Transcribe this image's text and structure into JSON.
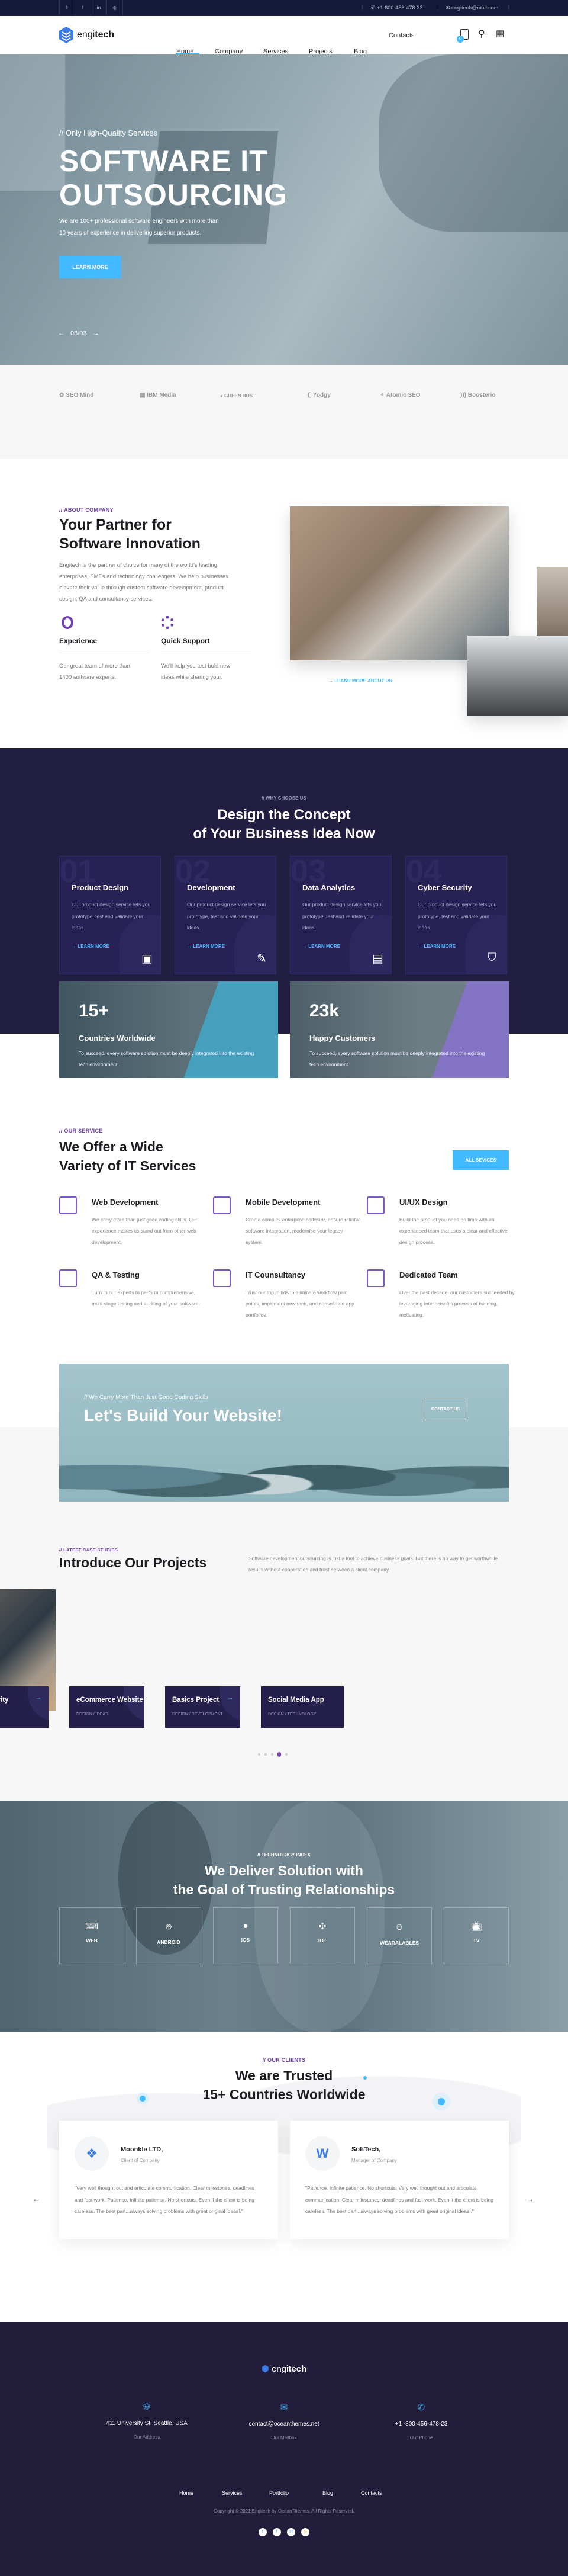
{
  "topbar": {
    "socials": [
      "twitter-icon",
      "facebook-icon",
      "linkedin-icon",
      "instagram-icon"
    ],
    "phone": "+1-800-456-478-23",
    "email": "engitech@mail.com"
  },
  "header": {
    "logo_light": "engi",
    "logo_bold": "tech",
    "nav": [
      "Home",
      "Company",
      "Services",
      "Projects",
      "Blog",
      "Contacts"
    ],
    "cart_count": "0"
  },
  "hero": {
    "kicker": "// Only High-Quality Services",
    "title_1": "SOFTWARE IT",
    "title_2": "OUTSOURCING",
    "text_1": "We are 100+ professional software engineers with more than",
    "text_2": "10 years of experience in delivering superior products.",
    "button": "LEARN MORE",
    "pager": "03/03"
  },
  "partners": [
    "SEO Mind",
    "IBM Media",
    "GREEN HOST",
    "Yodgy",
    "Atomic SEO",
    "Boosterio"
  ],
  "about": {
    "kicker": "// ABOUT COMPANY",
    "title_1": "Your Partner for",
    "title_2": "Software Innovation",
    "text": "Engitech is the partner of choice for many of the world's leading enterprises, SMEs and technology challengers. We help businesses elevate their value through custom software development, product design, QA and consultancy services.",
    "features": [
      {
        "title": "Experience",
        "text": "Our great team of more than 1400 software experts."
      },
      {
        "title": "Quick Support",
        "text": "We'll help you test bold new ideas while sharing your."
      }
    ],
    "link": "LEANR MORE ABOUT US"
  },
  "why": {
    "kicker": "// WHY CHOOSE US",
    "title_1": "Design the Concept",
    "title_2": "of Your Business Idea Now",
    "cards": [
      {
        "num": "01",
        "title": "Product Design",
        "text": "Our product design service lets you prototype, test and validate your ideas.",
        "link": "LEARN MORE"
      },
      {
        "num": "02",
        "title": "Development",
        "text": "Our product design service lets you prototype, test and validate your ideas.",
        "link": "LEARN MORE"
      },
      {
        "num": "03",
        "title": "Data Analytics",
        "text": "Our product design service lets you prototype, test and validate your ideas.",
        "link": "LEARN MORE"
      },
      {
        "num": "04",
        "title": "Cyber Security",
        "text": "Our product design service lets you prototype, test and validate your ideas.",
        "link": "LEARN MORE"
      }
    ]
  },
  "stats": [
    {
      "value": "15+",
      "title": "Countries Worldwide",
      "text": "To succeed, every software solution must be deeply integrated into the existing tech environment..",
      "accent": "#3fb3dc"
    },
    {
      "value": "23k",
      "title": "Happy Customers",
      "text": "To succeed, every software solution must be deeply integrated into the existing tech environment.",
      "accent": "#8b72d8"
    }
  ],
  "services": {
    "kicker": "// OUR SERVICE",
    "title_1": "We Offer a Wide",
    "title_2": "Variety of IT Services",
    "button": "ALL SEVICES",
    "items": [
      {
        "title": "Web Development",
        "text": "We carry more than just good coding skills. Our experience makes us stand out from other web development."
      },
      {
        "title": "Mobile Development",
        "text": "Create complex enterprise software, ensure reliable software integration, modernise your legacy system."
      },
      {
        "title": "UI/UX Design",
        "text": "Build the product you need on time with an experienced team that uses a clear and effective design process."
      },
      {
        "title": "QA & Testing",
        "text": "Turn to our experts to perform comprehensive, multi-stage testing and auditing of your software."
      },
      {
        "title": "IT Counsultancy",
        "text": "Trust our top minds to eliminate workflow pain points, implement new tech, and consolidate app portfolios."
      },
      {
        "title": "Dedicated Team",
        "text": "Over the past decade, our customers succeeded by leveraging Intellectsoft's process of building, motivating."
      }
    ]
  },
  "cta": {
    "kicker": "// We Carry More Than Just Good Coding Skills",
    "title": "Let's Build Your Website!",
    "button": "CONTACT US"
  },
  "projects": {
    "kicker": "// LATEST CASE STUDIES",
    "title": "Introduce Our Projects",
    "text": "Software development outsourcing is just a tool to achieve business goals. But there is no way to get worthwhile results without cooperation and trust between a client company.",
    "items": [
      {
        "title": "of Security",
        "tags": "NOLOGY"
      },
      {
        "title": "eCommerce Website",
        "tags": "DESIGN / IDEAS"
      },
      {
        "title": "Basics Project",
        "tags": "DESIGN / DEVELOPMENT"
      },
      {
        "title": "Social Media App",
        "tags": "DESIGN / TECHNOLOGY"
      }
    ],
    "active_dot": 4,
    "dots": 5
  },
  "tech": {
    "kicker": "// TECHNOLOGY INDEX",
    "title_1": "We Deliver Solution with",
    "title_2": "the Goal of Trusting Relationships",
    "tiles": [
      "WEB",
      "ANDROID",
      "IOS",
      "IOT",
      "WEARALABLES",
      "TV"
    ]
  },
  "clients": {
    "kicker": "// OUR CLIENTS",
    "title_1": "We are Trusted",
    "title_2": "15+ Countries Worldwide",
    "testimonials": [
      {
        "name": "Moonkle LTD,",
        "role": "Client of Company",
        "text": "\"Very well thought out and articulate communication. Clear milestones, deadlines and fast work. Patience. Infinite patience. No shortcuts. Even if the client is being careless. The best part...always solving problems with great original ideas!.\""
      },
      {
        "name": "SoftTech,",
        "role": "Manager of Company",
        "text": "\"Patience. Infinite patience. No shortcuts. Very well thought out and articulate communication. Clear milestones, deadlines and fast work. Even if the client is being careless. The best part...always solving problems with great original ideas!.\""
      }
    ]
  },
  "footer": {
    "logo_light": "engi",
    "logo_bold": "tech",
    "contacts": [
      {
        "value": "411 University St, Seattle, USA",
        "label": "Our Address"
      },
      {
        "value": "contact@oceanthemes.net",
        "label": "Our Mailbox"
      },
      {
        "value": "+1 -800-456-478-23",
        "label": "Our Phone"
      }
    ],
    "nav": [
      "Home",
      "Services",
      "Portfolio",
      "Blog",
      "Contacts"
    ],
    "copyright": "Copyright © 2021 Engitech by OceanThemes. All Rights Reserved."
  },
  "colors": {
    "accent": "#43baff",
    "purple": "#7141b1",
    "navy": "#221e41"
  }
}
